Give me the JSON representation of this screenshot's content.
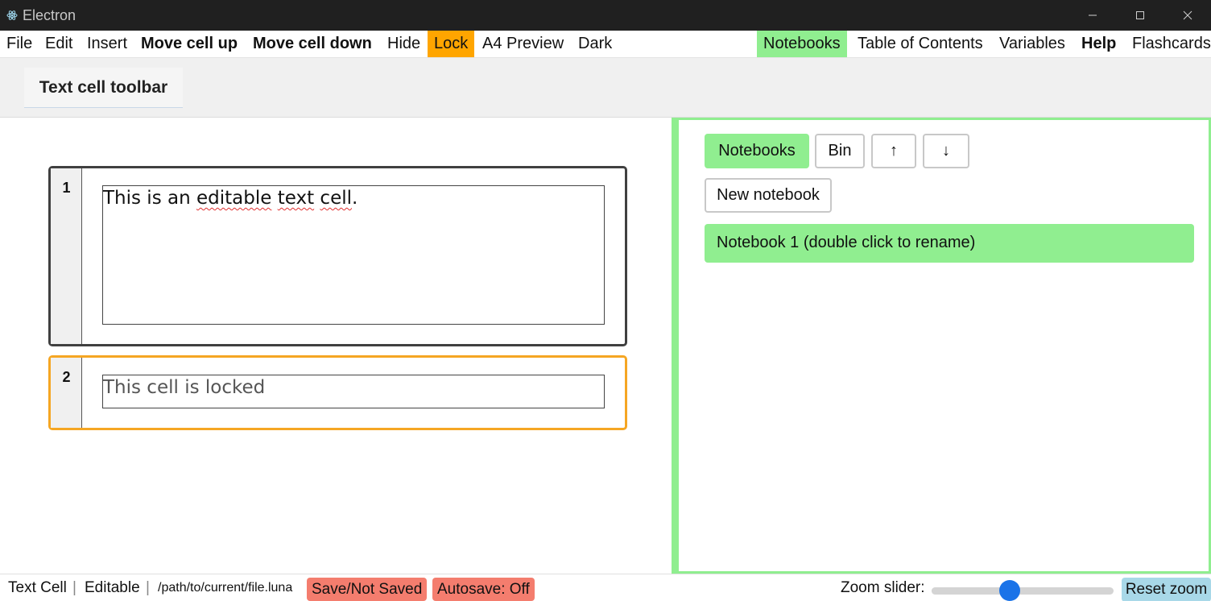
{
  "window": {
    "title": "Electron"
  },
  "menu": {
    "file": "File",
    "edit": "Edit",
    "insert": "Insert",
    "move_up": "Move cell up",
    "move_down": "Move cell down",
    "hide": "Hide",
    "lock": "Lock",
    "a4_preview": "A4 Preview",
    "dark": "Dark",
    "notebooks": "Notebooks",
    "toc": "Table of Contents",
    "variables": "Variables",
    "help": "Help",
    "flashcards": "Flashcards"
  },
  "toolbar": {
    "tab_label": "Text cell toolbar"
  },
  "cells": [
    {
      "number": "1",
      "text_parts": [
        "This is an ",
        "editable",
        " ",
        "text",
        " ",
        "cell",
        "."
      ]
    },
    {
      "number": "2",
      "text": "This cell is locked"
    }
  ],
  "panel": {
    "notebooks_button": "Notebooks",
    "bin_button": "Bin",
    "up_button": "↑",
    "down_button": "↓",
    "new_notebook_button": "New notebook",
    "notebooks": [
      {
        "name": "Notebook 1 (double click to rename)"
      }
    ]
  },
  "status": {
    "cell_type": "Text Cell",
    "separator": "|",
    "mode": "Editable",
    "file_path": "/path/to/current/file.luna",
    "save_state": "Save/Not Saved",
    "autosave": "Autosave: Off",
    "zoom_label": "Zoom slider:",
    "zoom_level": 0.43,
    "reset_zoom": "Reset zoom"
  },
  "colors": {
    "accent_green": "#90ee90",
    "lock_orange": "#ffa500",
    "locked_cell_border": "#f5a623",
    "status_badge_red": "#f47d6e",
    "slider_thumb_blue": "#1a73e8",
    "reset_zoom_blue": "#a8d8e8"
  }
}
